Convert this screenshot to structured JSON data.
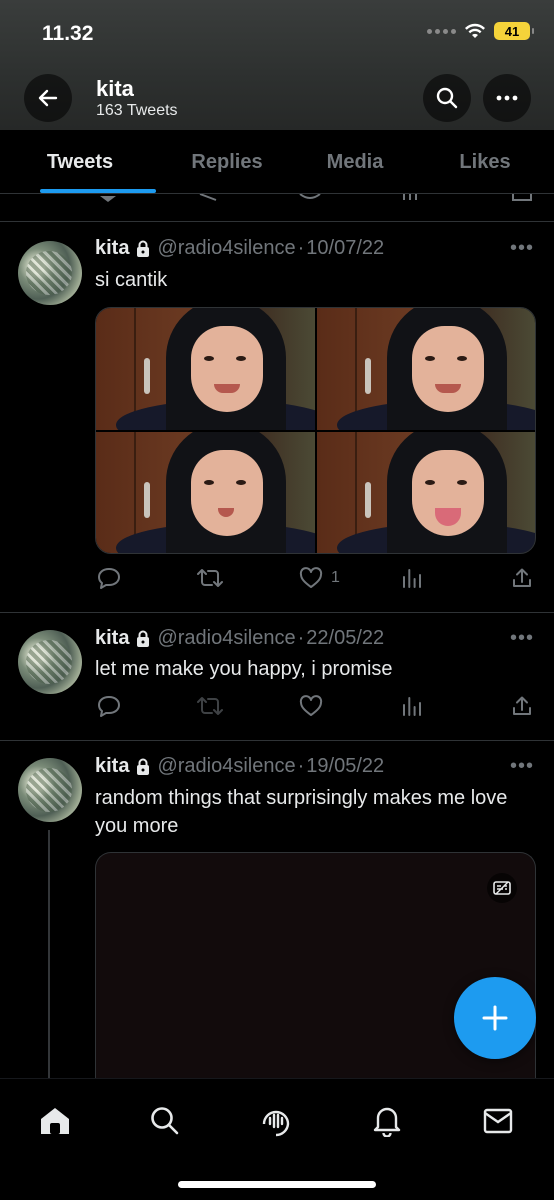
{
  "status": {
    "time": "11.32",
    "battery": "41"
  },
  "header": {
    "title": "kita",
    "subtitle": "163 Tweets"
  },
  "tabs": [
    {
      "label": "Tweets",
      "active": true
    },
    {
      "label": "Replies",
      "active": false
    },
    {
      "label": "Media",
      "active": false
    },
    {
      "label": "Likes",
      "active": false
    }
  ],
  "tweets": [
    {
      "name": "kita",
      "handle": "@radio4silence",
      "date": "10/07/22",
      "text": "si cantik",
      "likes": "1"
    },
    {
      "name": "kita",
      "handle": "@radio4silence",
      "date": "22/05/22",
      "text": "let me make you happy, i promise",
      "likes": ""
    },
    {
      "name": "kita",
      "handle": "@radio4silence",
      "date": "19/05/22",
      "text": "random things that surprisingly makes me love you more",
      "likes": ""
    }
  ],
  "colors": {
    "accent": "#1d9bf0",
    "muted": "#71767b",
    "text": "#e7e9ea"
  }
}
